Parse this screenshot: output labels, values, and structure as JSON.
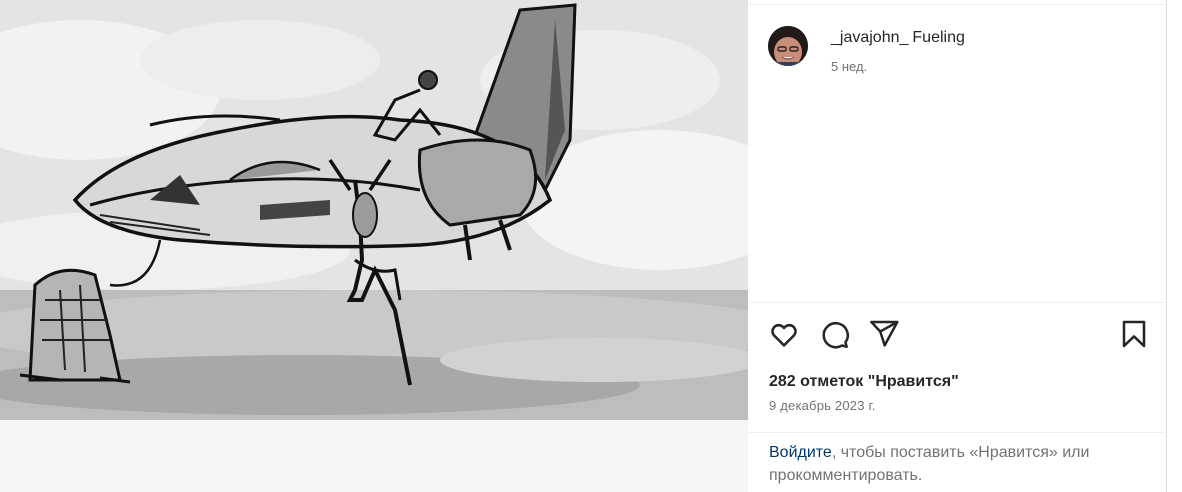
{
  "post": {
    "username": "_javajohn_",
    "caption": "Fueling",
    "time_ago": "5 нед.",
    "likes": "282 отметок \"Нравится\"",
    "date": "9 декабрь 2023 г."
  },
  "login_prompt": {
    "link": "Войдите",
    "text": ", чтобы поставить «Нравится» или прокомментировать."
  },
  "icons": {
    "like": "heart-icon",
    "comment": "comment-icon",
    "share": "share-icon",
    "save": "bookmark-icon"
  }
}
